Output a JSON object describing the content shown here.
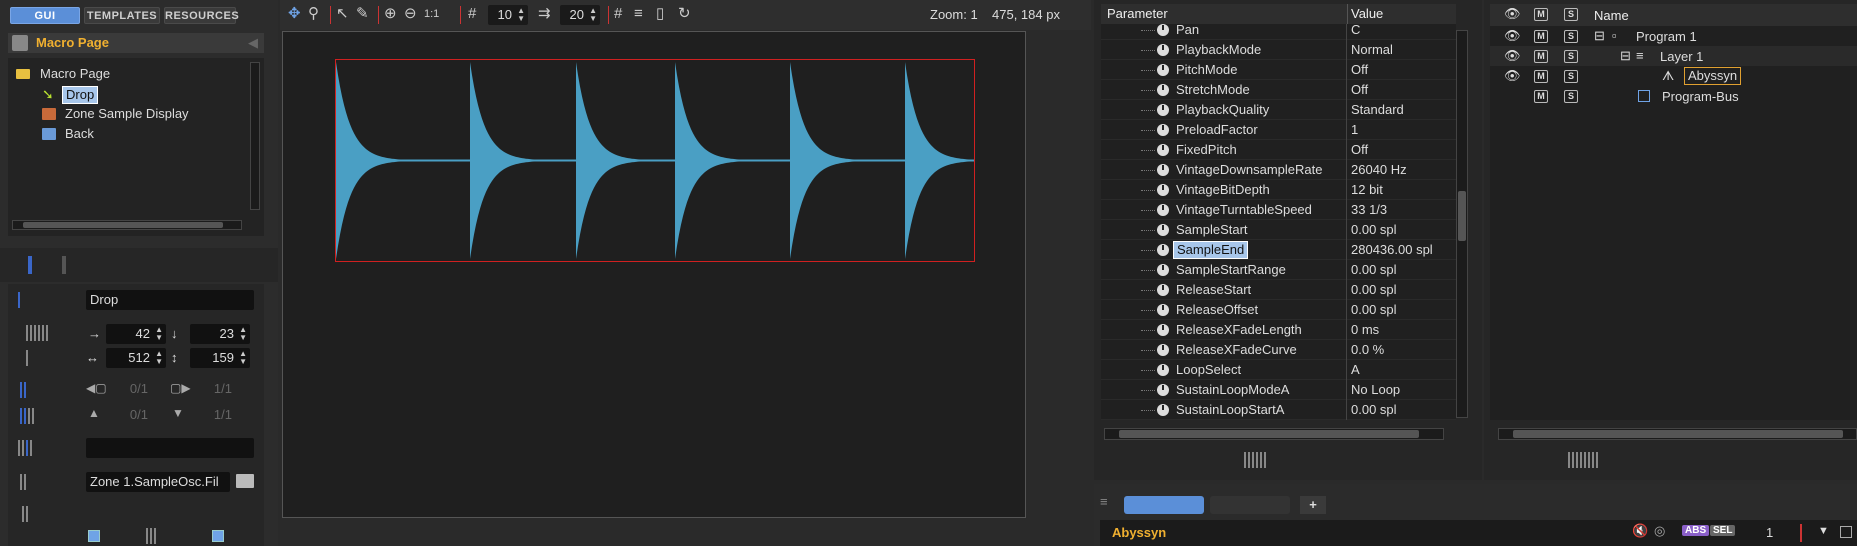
{
  "left": {
    "tabs": {
      "gui": "GUI",
      "templates": "TEMPLATES",
      "resources": "RESOURCES"
    },
    "panel_title": "Macro Page",
    "tree": [
      {
        "label": "Macro Page"
      },
      {
        "label": "Drop"
      },
      {
        "label": "Zone Sample Display"
      },
      {
        "label": "Back"
      }
    ],
    "props": {
      "name": "Drop",
      "x": "42",
      "y": "23",
      "w": "512",
      "h": "159",
      "range1_from": "0/1",
      "range1_to": "1/1",
      "range2_from": "0/1",
      "range2_to": "1/1",
      "value_field": "",
      "sample_field": "Zone 1.SampleOsc.Fil"
    }
  },
  "toolbar": {
    "grid_x": "10",
    "grid_y": "20",
    "ratio_label": "1:1",
    "zoom": "Zoom: 1",
    "coords": "475, 184 px"
  },
  "params": {
    "col_param": "Parameter",
    "col_value": "Value",
    "rows": [
      {
        "name": "Pan",
        "value": "C"
      },
      {
        "name": "PlaybackMode",
        "value": "Normal"
      },
      {
        "name": "PitchMode",
        "value": "Off"
      },
      {
        "name": "StretchMode",
        "value": "Off"
      },
      {
        "name": "PlaybackQuality",
        "value": "Standard"
      },
      {
        "name": "PreloadFactor",
        "value": "1"
      },
      {
        "name": "FixedPitch",
        "value": "Off"
      },
      {
        "name": "VintageDownsampleRate",
        "value": "26040 Hz"
      },
      {
        "name": "VintageBitDepth",
        "value": "12 bit"
      },
      {
        "name": "VintageTurntableSpeed",
        "value": "33 1/3"
      },
      {
        "name": "SampleStart",
        "value": "0.00 spl"
      },
      {
        "name": "SampleEnd",
        "value": "280436.00 spl"
      },
      {
        "name": "SampleStartRange",
        "value": "0.00 spl"
      },
      {
        "name": "ReleaseStart",
        "value": "0.00 spl"
      },
      {
        "name": "ReleaseOffset",
        "value": "0.00 spl"
      },
      {
        "name": "ReleaseXFadeLength",
        "value": "0 ms"
      },
      {
        "name": "ReleaseXFadeCurve",
        "value": "0.0 %"
      },
      {
        "name": "LoopSelect",
        "value": "A"
      },
      {
        "name": "SustainLoopModeA",
        "value": "No Loop"
      },
      {
        "name": "SustainLoopStartA",
        "value": "0.00 spl"
      }
    ]
  },
  "program_tree": {
    "col_name": "Name",
    "items": [
      {
        "label": "Program 1"
      },
      {
        "label": "Layer 1"
      },
      {
        "label": "Abyssyn"
      },
      {
        "label": "Program-Bus"
      }
    ]
  },
  "bottom": {
    "instrument": "Abyssyn",
    "abs": "ABS",
    "sel": "SEL",
    "count": "1",
    "add": "+"
  },
  "colors": {
    "accent": "#5b8fd8",
    "waveform": "#4a9fc4",
    "selection": "#d02020",
    "label_gold": "#f0b030"
  }
}
